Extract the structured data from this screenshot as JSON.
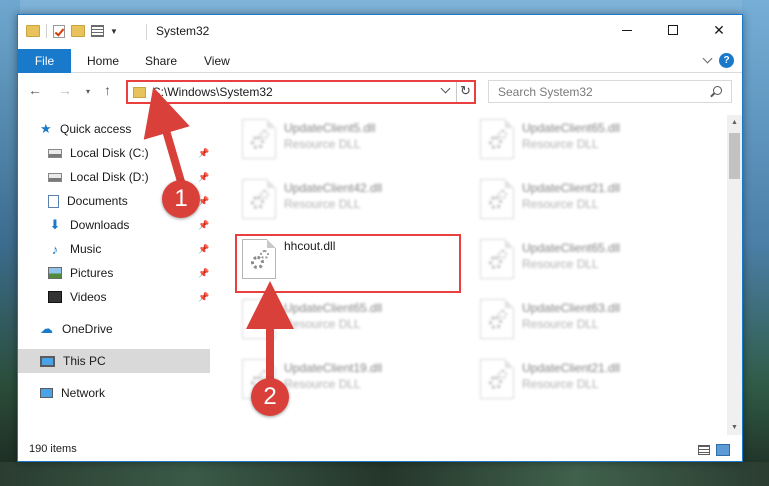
{
  "window": {
    "title": "System32",
    "minimize_glyph": "—",
    "maximize_glyph": "☐",
    "close_glyph": "✕"
  },
  "ribbon": {
    "tabs": [
      "File",
      "Home",
      "Share",
      "View"
    ],
    "help_glyph": "?"
  },
  "nav": {
    "back_glyph": "←",
    "forward_glyph": "→",
    "recent_glyph": "▾",
    "up_glyph": "↑",
    "address": "C:\\Windows\\System32",
    "refresh_glyph": "↻",
    "search_placeholder": "Search System32"
  },
  "sidebar": {
    "items": [
      {
        "label": "Quick access",
        "icon": "star-icon"
      },
      {
        "label": "Local Disk (C:)",
        "icon": "drive-icon",
        "pinned": true
      },
      {
        "label": "Local Disk (D:)",
        "icon": "drive-icon",
        "pinned": true
      },
      {
        "label": "Documents",
        "icon": "documents-icon",
        "pinned": true
      },
      {
        "label": "Downloads",
        "icon": "download-icon",
        "pinned": true
      },
      {
        "label": "Music",
        "icon": "music-icon",
        "pinned": true
      },
      {
        "label": "Pictures",
        "icon": "pictures-icon",
        "pinned": true
      },
      {
        "label": "Videos",
        "icon": "video-icon",
        "pinned": true
      },
      {
        "label": "OneDrive",
        "icon": "cloud-icon"
      },
      {
        "label": "This PC",
        "icon": "computer-icon",
        "selected": true
      },
      {
        "label": "Network",
        "icon": "network-icon"
      }
    ],
    "pin_glyph": "📌"
  },
  "files": [
    {
      "name": "UpdateClient5.dll",
      "type": "Resource DLL"
    },
    {
      "name": "UpdateClient65.dll",
      "type": "Resource DLL"
    },
    {
      "name": "UpdateClient42.dll",
      "type": "Resource DLL"
    },
    {
      "name": "UpdateClient21.dll",
      "type": "Resource DLL"
    },
    {
      "name": "hhcout.dll",
      "type": ""
    },
    {
      "name": "UpdateClient65.dll",
      "type": "Resource DLL"
    },
    {
      "name": "UpdateClient65.dll",
      "type": "Resource DLL"
    },
    {
      "name": "UpdateClient63.dll",
      "type": "Resource DLL"
    },
    {
      "name": "UpdateClient19.dll",
      "type": "Resource DLL"
    },
    {
      "name": "UpdateClient21.dll",
      "type": "Resource DLL"
    }
  ],
  "status": {
    "item_count": "190 items"
  },
  "annotations": {
    "badge1": "1",
    "badge2": "2",
    "color": "#d9403a"
  },
  "colors": {
    "accent": "#1979ca",
    "highlight_border": "#e8403f"
  }
}
